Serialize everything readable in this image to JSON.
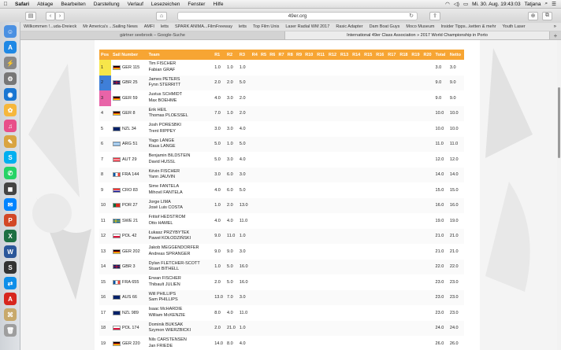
{
  "menubar": {
    "apple": "",
    "app": "Safari",
    "items": [
      "Ablage",
      "Bearbeiten",
      "Darstellung",
      "Verlauf",
      "Lesezeichen",
      "Fenster",
      "Hilfe"
    ],
    "clock": "Mi. 30. Aug.  19:43:03",
    "user": "Tatjana"
  },
  "toolbar": {
    "url": "49er.org"
  },
  "favorites": [
    "Willkommen !...uda-Dreieck",
    "Mr America's ...Sailing News",
    "AMFI",
    "letts",
    "SPARK ANIMA...FilmFreeway",
    "letts",
    "Top Film Unis",
    "Laser Radial WM 2017",
    "Rasic Adapter",
    "Dam Boat Guys",
    "Moco Museum",
    "Insider Tipps...ketten & mehr",
    "Youth Laser"
  ],
  "tabs": [
    "gärtner seebrook – Google-Suche",
    "International 49er Class Association » 2017 World Championship in Porto"
  ],
  "table": {
    "headers": [
      "Pos",
      "Sail Number",
      "Team",
      "R1",
      "R2",
      "R3",
      "R4",
      "R5",
      "R6",
      "R7",
      "R8",
      "R9",
      "R10",
      "R11",
      "R12",
      "R13",
      "R14",
      "R15",
      "R16",
      "R17",
      "R18",
      "R19",
      "R20",
      "Total",
      "Netto"
    ],
    "rows": [
      {
        "pos": "1",
        "sail": "GER 115",
        "flag": "ger",
        "team": [
          "Tim FISCHER",
          "Fabian GRAF"
        ],
        "r": [
          "1.0",
          "1.0",
          "1.0"
        ],
        "total": "3.0",
        "net": "3.0",
        "hl": "#f7e64a"
      },
      {
        "pos": "2",
        "sail": "GBR 25",
        "flag": "gbr",
        "team": [
          "James PETERS",
          "Fynn STERRITT"
        ],
        "r": [
          "2.0",
          "2.0",
          "5.0"
        ],
        "total": "9.0",
        "net": "9.0",
        "hl": "#3f7fd8"
      },
      {
        "pos": "3",
        "sail": "GER 59",
        "flag": "ger",
        "team": [
          "Justus SCHMIDT",
          "Max BOEHME"
        ],
        "r": [
          "4.0",
          "3.0",
          "2.0"
        ],
        "total": "9.0",
        "net": "9.0",
        "hl": "#e864a8"
      },
      {
        "pos": "4",
        "sail": "GER 8",
        "flag": "ger",
        "team": [
          "Erik HEIL",
          "Thomas PLOESSEL"
        ],
        "r": [
          "7.0",
          "1.0",
          "2.0"
        ],
        "total": "10.0",
        "net": "10.0"
      },
      {
        "pos": "5",
        "sail": "NZL 34",
        "flag": "nzl",
        "team": [
          "Josh PORESBKI",
          "Trent RIPPEY"
        ],
        "r": [
          "3.0",
          "3.0",
          "4.0"
        ],
        "total": "10.0",
        "net": "10.0"
      },
      {
        "pos": "6",
        "sail": "ARG 51",
        "flag": "arg",
        "team": [
          "Yago LANGE",
          "Klaus LANGE"
        ],
        "r": [
          "5.0",
          "1.0",
          "5.0"
        ],
        "total": "11.0",
        "net": "11.0"
      },
      {
        "pos": "7",
        "sail": "AUT 29",
        "flag": "aut",
        "team": [
          "Benjamin BILDSTEIN",
          "David HUSSL"
        ],
        "r": [
          "5.0",
          "3.0",
          "4.0"
        ],
        "total": "12.0",
        "net": "12.0"
      },
      {
        "pos": "8",
        "sail": "FRA 144",
        "flag": "fra",
        "team": [
          "Kévin FISCHER",
          "Yann JAUVIN"
        ],
        "r": [
          "3.0",
          "6.0",
          "3.0"
        ],
        "total": "14.0",
        "net": "14.0"
      },
      {
        "pos": "9",
        "sail": "CRO 83",
        "flag": "cro",
        "team": [
          "Sime FANTELA",
          "Mihovil FANTELA"
        ],
        "r": [
          "4.0",
          "6.0",
          "5.0"
        ],
        "total": "15.0",
        "net": "15.0"
      },
      {
        "pos": "10",
        "sail": "POR 27",
        "flag": "por",
        "team": [
          "Jorge LIMA",
          "José Luis COSTA"
        ],
        "r": [
          "1.0",
          "2.0",
          "13.0"
        ],
        "total": "16.0",
        "net": "16.0"
      },
      {
        "pos": "11",
        "sail": "SWE 21",
        "flag": "swe",
        "team": [
          "Fritiof HEDSTROM",
          "Otto HAMEL"
        ],
        "r": [
          "4.0",
          "4.0",
          "11.0"
        ],
        "total": "19.0",
        "net": "19.0"
      },
      {
        "pos": "12",
        "sail": "POL 42",
        "flag": "pol",
        "team": [
          "Łukasz PRZYBYTEK",
          "Paweł KOŁODZIŃSKI"
        ],
        "r": [
          "9.0",
          "11.0",
          "1.0"
        ],
        "total": "21.0",
        "net": "21.0"
      },
      {
        "pos": "13",
        "sail": "GER 202",
        "flag": "ger",
        "team": [
          "Jakob MEGGENDORFER",
          "Andreas SPRANGER"
        ],
        "r": [
          "9.0",
          "9.0",
          "3.0"
        ],
        "total": "21.0",
        "net": "21.0"
      },
      {
        "pos": "14",
        "sail": "GBR 3",
        "flag": "gbr",
        "team": [
          "Dylan FLETCHER-SCOTT",
          "Stuart BITHELL"
        ],
        "r": [
          "1.0",
          "5.0",
          "16.0"
        ],
        "total": "22.0",
        "net": "22.0"
      },
      {
        "pos": "15",
        "sail": "FRA 655",
        "flag": "fra",
        "team": [
          "Erwan FISCHER",
          "Thibault JULIEN"
        ],
        "r": [
          "2.0",
          "5.0",
          "16.0"
        ],
        "total": "23.0",
        "net": "23.0"
      },
      {
        "pos": "16",
        "sail": "AUS 66",
        "flag": "aus",
        "team": [
          "Will PHILLIPS",
          "Sam PHILLIPS"
        ],
        "r": [
          "13.0",
          "7.0",
          "3.0"
        ],
        "total": "23.0",
        "net": "23.0"
      },
      {
        "pos": "17",
        "sail": "NZL 989",
        "flag": "nzl",
        "team": [
          "Isaac McHARDIE",
          "William McKENZIE"
        ],
        "r": [
          "8.0",
          "4.0",
          "11.0"
        ],
        "total": "23.0",
        "net": "23.0"
      },
      {
        "pos": "18",
        "sail": "POL 174",
        "flag": "pol",
        "team": [
          "Dominik BUKSAK",
          "Szymon WIERZBICKI"
        ],
        "r": [
          "2.0",
          "21.0",
          "1.0"
        ],
        "total": "24.0",
        "net": "24.0"
      },
      {
        "pos": "19",
        "sail": "GER 220",
        "flag": "ger",
        "team": [
          "Nils CARSTENSEN",
          "Jan FRIEDE"
        ],
        "r": [
          "14.0",
          "8.0",
          "4.0"
        ],
        "total": "26.0",
        "net": "26.0"
      }
    ]
  },
  "dock": [
    "finder-icon",
    "app-store-icon",
    "launchpad-icon",
    "system-preferences-icon",
    "safari-icon",
    "photos-icon",
    "itunes-icon",
    "notes-icon",
    "skype-icon",
    "whatsapp-icon",
    "camera-icon",
    "messenger-icon",
    "powerpoint-icon",
    "excel-icon",
    "word-icon",
    "schools-icon",
    "teamviewer-icon",
    "acrobat-icon",
    "preview-icon",
    "trash-icon"
  ]
}
